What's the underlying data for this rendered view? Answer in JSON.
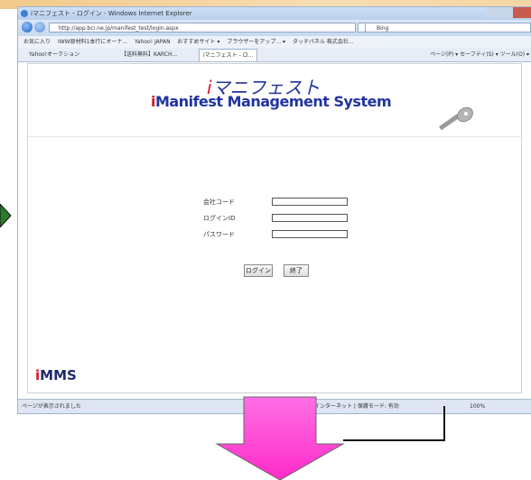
{
  "browser": {
    "title": "iマニフェスト - ログイン - Windows Internet Explorer",
    "url": "http://app.bci.ne.jp/manifest_test/login.aspx",
    "search_placeholder": "Bing",
    "favorites_label": "お気に入り",
    "favorites_items": [
      "IWW原材料1本行にオーナ...",
      "Yahoo! JAPAN",
      "おすすめサイト ▾",
      "ブラウザーをアップ... ▾",
      "タッチパネル 株式会社..."
    ],
    "tabs": [
      "Yahoo!オークション",
      "【送料無料】KARCH...",
      "iマニフェスト - ロ..."
    ],
    "tools_right": "ページ(P) ▾  セーフティ(S) ▾  ツール(O) ▾",
    "status_text": "ページが表示されました",
    "status_zone": "インターネット | 保護モード: 有効",
    "zoom": "100%"
  },
  "page": {
    "logo_top": "マニフェスト",
    "logo_top_prefix": "i",
    "logo_bottom": "Manifest Management System",
    "logo_bottom_prefix": "i",
    "fields": [
      {
        "label": "会社コード",
        "value": ""
      },
      {
        "label": "ログインID",
        "value": ""
      },
      {
        "label": "パスワード",
        "value": ""
      }
    ],
    "login_button": "ログイン",
    "exit_button": "終了",
    "footer_logo": "MMS",
    "footer_logo_prefix": "i"
  },
  "colors": {
    "brand_blue": "#2233a0",
    "brand_red": "#d3162c",
    "arrow_magenta": "#ff4bd6"
  },
  "icons": [
    "ie-logo-icon",
    "back-icon",
    "forward-icon",
    "key-icon",
    "down-arrow-icon",
    "left-arrow-icon"
  ]
}
